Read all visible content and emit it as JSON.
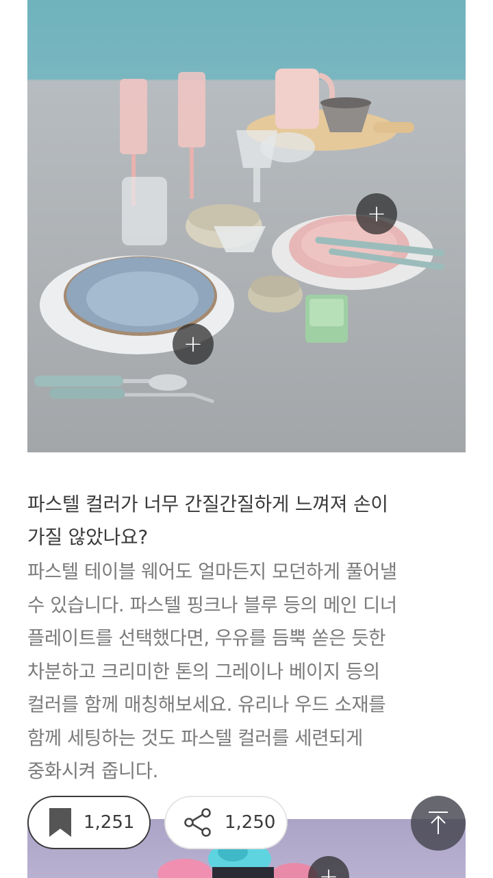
{
  "hero": {
    "hotspots": [
      {
        "label": "+"
      },
      {
        "label": "+"
      }
    ]
  },
  "article": {
    "title_lines": [
      "파스텔 컬러가 너무 간질간질하게 느껴져 손이",
      "가질 않았나요?"
    ],
    "body_lines": [
      "파스텔 테이블 웨어도 얼마든지 모던하게 풀어낼",
      "수 있습니다. 파스텔 핑크나 블루 등의 메인 디너",
      "플레이트를 선택했다면, 우유를 듬뿍 쏟은 듯한",
      "차분하고 크리미한 톤의 그레이나 베이지 등의",
      "컬러를 함께 매칭해보세요. 유리나 우드 소재를",
      "함께 세팅하는 것도 파스텔 컬러를 세련되게",
      "중화시켜 줍니다."
    ]
  },
  "actions": {
    "bookmark_count": "1,251",
    "share_count": "1,250",
    "bookmark_icon": "bookmark-icon",
    "share_icon": "share-icon",
    "top_icon": "arrow-up-icon"
  },
  "next_card": {
    "hotspot_label": "+"
  },
  "colors": {
    "wall": "#79b6c0",
    "table": "#aeb2b5",
    "pink": "#e8c3c1",
    "blue": "#8fa8bd",
    "mint": "#9fd3a6"
  }
}
